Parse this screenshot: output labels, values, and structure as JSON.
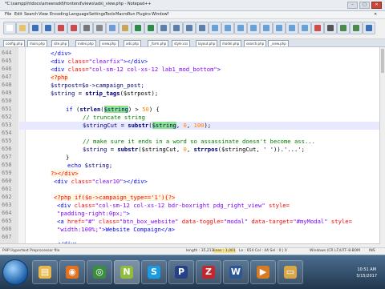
{
  "window": {
    "title": "*C:\\xampp\\htdocs\\ameeradd\\frontend\\views\\ads\\_view.php - Notepad++",
    "buttons": {
      "min": "–",
      "max": "□",
      "close": "✕"
    }
  },
  "menubar": [
    "File",
    "Edit",
    "Search",
    "View",
    "Encoding",
    "Language",
    "Settings",
    "Tools",
    "Macro",
    "Run",
    "Plugins",
    "Window",
    "?"
  ],
  "toolbar_icons": [
    {
      "name": "new-file-icon",
      "color": "#ffffff"
    },
    {
      "name": "open-file-icon",
      "color": "#e8c36a"
    },
    {
      "name": "save-icon",
      "color": "#3b6fb6"
    },
    {
      "name": "save-all-icon",
      "color": "#3b6fb6"
    },
    {
      "name": "close-icon",
      "color": "#c94c4c"
    },
    {
      "name": "close-all-icon",
      "color": "#c94c4c"
    },
    {
      "name": "print-icon",
      "color": "#777777"
    },
    {
      "name": "cut-icon",
      "color": "#888888"
    },
    {
      "name": "copy-icon",
      "color": "#6d9bd6"
    },
    {
      "name": "paste-icon",
      "color": "#c9a55a"
    },
    {
      "name": "undo-icon",
      "color": "#2f8a4a"
    },
    {
      "name": "redo-icon",
      "color": "#2f8a4a"
    },
    {
      "name": "find-icon",
      "color": "#5a7fa8"
    },
    {
      "name": "replace-icon",
      "color": "#5a7fa8"
    },
    {
      "name": "zoom-in-icon",
      "color": "#5a7fa8"
    },
    {
      "name": "zoom-out-icon",
      "color": "#5a7fa8"
    },
    {
      "name": "sync-v-icon",
      "color": "#6aa0d8"
    },
    {
      "name": "sync-h-icon",
      "color": "#6aa0d8"
    },
    {
      "name": "wrap-icon",
      "color": "#6aa0d8"
    },
    {
      "name": "all-chars-icon",
      "color": "#6aa0d8"
    },
    {
      "name": "indent-guide-icon",
      "color": "#6aa0d8"
    },
    {
      "name": "lang-icon",
      "color": "#6aa0d8"
    },
    {
      "name": "doc-map-icon",
      "color": "#6aa0d8"
    },
    {
      "name": "function-list-icon",
      "color": "#6aa0d8"
    },
    {
      "name": "record-macro-icon",
      "color": "#d24b4b"
    },
    {
      "name": "stop-macro-icon",
      "color": "#555555"
    },
    {
      "name": "play-macro-icon",
      "color": "#4a8a4a"
    },
    {
      "name": "run-macro-icon",
      "color": "#4a8a4a"
    },
    {
      "name": "save-macro-icon",
      "color": "#3b6fb6"
    }
  ],
  "tabs": [
    {
      "label": "config.php"
    },
    {
      "label": "main.php"
    },
    {
      "label": "site.php"
    },
    {
      "label": "index.php"
    },
    {
      "label": "view.php"
    },
    {
      "label": "ads.php"
    },
    {
      "label": "_form.php"
    },
    {
      "label": "style.css"
    },
    {
      "label": "layout.php"
    },
    {
      "label": "model.php"
    },
    {
      "label": "search.php"
    },
    {
      "label": "_view.php"
    }
  ],
  "editor": {
    "line_numbers": [
      "644",
      "645",
      "646",
      "647",
      "648",
      "649",
      "650",
      "651",
      "652",
      "653",
      "654",
      "655",
      "656",
      "657",
      "658",
      "659",
      "660",
      "661",
      "662",
      "663",
      "664",
      "665",
      "666",
      "667"
    ],
    "lines": {
      "l644": "</div>",
      "l645_open": "<div ",
      "l645_attr": "class=",
      "l645_val": "\"clearfix\"",
      "l645_close": "></div>",
      "l646_open": "<div ",
      "l646_attr": "class=",
      "l646_val": "\"col-sm-12 col-xs-12 lab1_mod_bottom\"",
      "l646_close": ">",
      "l647": "<?php",
      "l648": "$strpost=$o->campaign_post;",
      "l649_var": "$string",
      "l649_eq": " = ",
      "l649_fn": "strip_tags",
      "l649_rest": "($strpost);",
      "l651_kw": "if",
      "l651_a": " (",
      "l651_fn": "strlen",
      "l651_b": "(",
      "l651_var": "$string",
      "l651_c": ") > ",
      "l651_num": "50",
      "l651_d": ") {",
      "l653": "// truncate string",
      "l654_a": "$stringCut = ",
      "l654_fn": "substr",
      "l654_b": "(",
      "l654_var": "$string",
      "l654_c": ", ",
      "l654_n1": "0",
      "l654_d": ", ",
      "l654_n2": "100",
      "l654_e": ");",
      "l656": "// make sure it ends in a word so assassinate doesn't become ass...",
      "l657_var": "$string",
      "l657_a": " = ",
      "l657_fn": "substr",
      "l657_b": "($stringCut, ",
      "l657_n": "0",
      "l657_c": ", ",
      "l657_fn2": "strrpos",
      "l657_d": "($stringCut, ' ')).'...';",
      "l658": "}",
      "l659_kw": "echo",
      "l659_rest": " $string;",
      "l660": "?></div>",
      "l661_open": "<div ",
      "l661_attr": "class=",
      "l661_val": "\"clear10\"",
      "l661_close": "></div>",
      "l663": "<?php if($o->campaign_type=='1'){?>",
      "l664_open": "<div ",
      "l664_attr": "class=",
      "l664_val": "\"col-sm-12 col-xs-12 bdr-boxright pdg_right_view\"",
      "l664_attr2": " style=",
      "l665_val": "\"padding-right:0px;\"",
      "l665_close": ">",
      "l666_open": "<a ",
      "l666_attr": "href=",
      "l666_val": "\"#\"",
      "l666_attr2": " class=",
      "l666_val2": "\"btn_box_website\"",
      "l666_attr3": " data-toggle=",
      "l666_val3": "\"modal\"",
      "l666_attr4": " data-target=",
      "l666_val4": "\"#myModal\"",
      "l666_attr5": " style=",
      "l667_val": "\"width:100%;\"",
      "l667_text": ">Website Compaign</a>",
      "l669": "</div>"
    }
  },
  "statusbar": {
    "file_type": "PHP Hypertext Preprocessor file",
    "length": "length : 35,213",
    "lines": "lines : 1,001",
    "position": "Ln : 654   Col : 44   Sel : 0 | 0",
    "eol": "Windows (CR LF)",
    "encoding": "UTF-8-BOM",
    "mode": "INS"
  },
  "taskbar": {
    "apps": [
      {
        "name": "explorer-icon",
        "glyph": "▤",
        "color": "#e7b84a"
      },
      {
        "name": "firefox-icon",
        "glyph": "◉",
        "color": "#e2721f"
      },
      {
        "name": "chrome-icon",
        "glyph": "◎",
        "color": "#3c8e3f"
      },
      {
        "name": "notepadpp-icon",
        "glyph": "N",
        "color": "#8fbe3a"
      },
      {
        "name": "skype-icon",
        "glyph": "S",
        "color": "#1a9ce2"
      },
      {
        "name": "photoshop-icon",
        "glyph": "P",
        "color": "#27408a"
      },
      {
        "name": "filezilla-icon",
        "glyph": "Z",
        "color": "#c1272d"
      },
      {
        "name": "word-icon",
        "glyph": "W",
        "color": "#2b5797"
      },
      {
        "name": "media-icon",
        "glyph": "▶",
        "color": "#d97b22"
      },
      {
        "name": "folder-icon",
        "glyph": "▭",
        "color": "#d7a84a"
      }
    ],
    "clock_time": "10:51 AM",
    "clock_date": "5/15/2017"
  },
  "colors": {
    "keyword": "#0000ff",
    "attribute": "#ff0000",
    "string": "#8000ff",
    "comment": "#008000",
    "number": "#ff8000",
    "highlight": "#8ee58e"
  }
}
